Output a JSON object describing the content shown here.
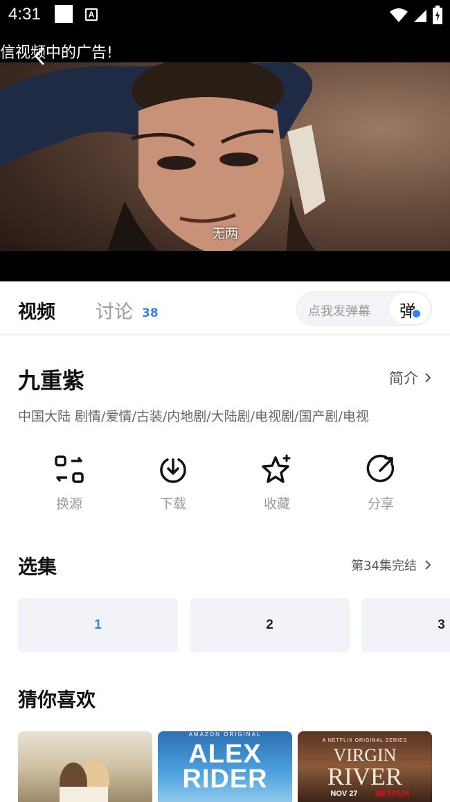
{
  "status_bar": {
    "time": "4:31",
    "notif_icon": "a-icon"
  },
  "player": {
    "ad_banner": "信视频中的广告!",
    "subtitle": "无两"
  },
  "tabs": {
    "video_label": "视频",
    "discussion_label": "讨论",
    "discussion_count": "38",
    "danmu_placeholder": "点我发弹幕",
    "danmu_button": "弹"
  },
  "show": {
    "title": "九重紫",
    "intro_label": "简介",
    "meta": "中国大陆  剧情/爱情/古装/内地剧/大陆剧/电视剧/国产剧/电视"
  },
  "actions": [
    {
      "label": "换源",
      "icon": "switch-source-icon"
    },
    {
      "label": "下载",
      "icon": "download-icon"
    },
    {
      "label": "收藏",
      "icon": "star-icon"
    },
    {
      "label": "分享",
      "icon": "share-icon"
    }
  ],
  "episodes": {
    "section_title": "选集",
    "status": "第34集完结",
    "items": [
      "1",
      "2",
      "3"
    ],
    "selected": "1"
  },
  "recommend": {
    "section_title": "猜你喜欢",
    "items": [
      {
        "poster_text": ""
      },
      {
        "top_text": "AMAZON ORIGINAL",
        "title_line1": "ALEX",
        "title_line2": "RIDER"
      },
      {
        "top_text": "A NETFLIX ORIGINAL SERIES",
        "title_line1": "VIRGIN",
        "title_line2": "RIVER",
        "date": "NOV 27",
        "brand": "NETFLIX"
      }
    ]
  }
}
